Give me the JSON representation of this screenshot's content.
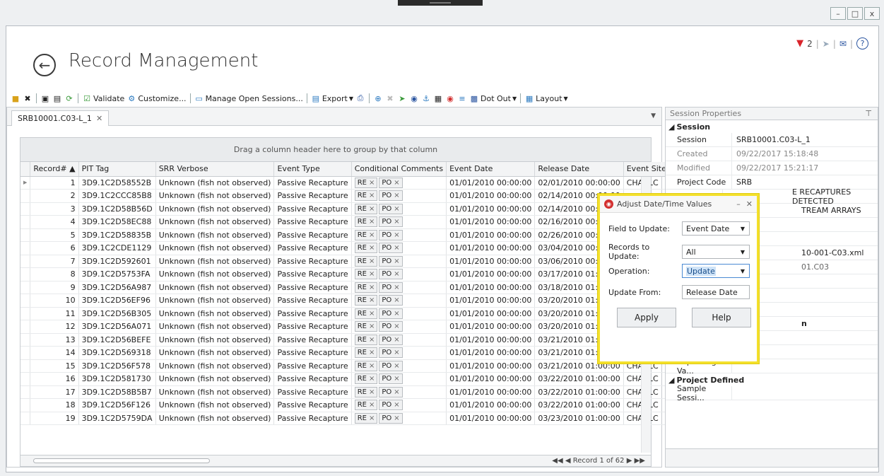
{
  "window": {
    "minimize": "–",
    "maximize": "□",
    "close": "x"
  },
  "header": {
    "title": "Record Management",
    "flag_count": "2"
  },
  "toolbar": {
    "validate": "Validate",
    "customize": "Customize...",
    "manage_sessions": "Manage Open Sessions...",
    "export": "Export",
    "dot_out": "Dot Out",
    "layout": "Layout"
  },
  "tab": {
    "label": "SRB10001.C03-L_1"
  },
  "grid": {
    "group_hint": "Drag a column header here to group by that column",
    "columns": [
      "Record#",
      "PIT Tag",
      "SRR Verbose",
      "Event Type",
      "Conditional Comments",
      "Event Date",
      "Release Date",
      "Event Site"
    ],
    "rows": [
      [
        "1",
        "3D9.1C2D58552B",
        "Unknown (fish not observed)",
        "Passive Recapture",
        "01/01/2010 00:00:00",
        "02/01/2010 00:00:00",
        "CHARLC"
      ],
      [
        "2",
        "3D9.1C2CCC85B8",
        "Unknown (fish not observed)",
        "Passive Recapture",
        "01/01/2010 00:00:00",
        "02/14/2010 00:00:00",
        ""
      ],
      [
        "3",
        "3D9.1C2D58B56D",
        "Unknown (fish not observed)",
        "Passive Recapture",
        "01/01/2010 00:00:00",
        "02/14/2010 00:00:00",
        ""
      ],
      [
        "4",
        "3D9.1C2D58EC88",
        "Unknown (fish not observed)",
        "Passive Recapture",
        "01/01/2010 00:00:00",
        "02/16/2010 00:00:00",
        ""
      ],
      [
        "5",
        "3D9.1C2D58835B",
        "Unknown (fish not observed)",
        "Passive Recapture",
        "01/01/2010 00:00:00",
        "02/26/2010 00:00:00",
        ""
      ],
      [
        "6",
        "3D9.1C2CDE1129",
        "Unknown (fish not observed)",
        "Passive Recapture",
        "01/01/2010 00:00:00",
        "03/04/2010 00:00:00",
        ""
      ],
      [
        "7",
        "3D9.1C2D592601",
        "Unknown (fish not observed)",
        "Passive Recapture",
        "01/01/2010 00:00:00",
        "03/06/2010 00:00:00",
        ""
      ],
      [
        "8",
        "3D9.1C2D5753FA",
        "Unknown (fish not observed)",
        "Passive Recapture",
        "01/01/2010 00:00:00",
        "03/17/2010 01:00:00",
        ""
      ],
      [
        "9",
        "3D9.1C2D56A987",
        "Unknown (fish not observed)",
        "Passive Recapture",
        "01/01/2010 00:00:00",
        "03/18/2010 01:00:00",
        ""
      ],
      [
        "10",
        "3D9.1C2D56EF96",
        "Unknown (fish not observed)",
        "Passive Recapture",
        "01/01/2010 00:00:00",
        "03/20/2010 01:00:00",
        ""
      ],
      [
        "11",
        "3D9.1C2D56B305",
        "Unknown (fish not observed)",
        "Passive Recapture",
        "01/01/2010 00:00:00",
        "03/20/2010 01:00:00",
        ""
      ],
      [
        "12",
        "3D9.1C2D56A071",
        "Unknown (fish not observed)",
        "Passive Recapture",
        "01/01/2010 00:00:00",
        "03/20/2010 01:00:00",
        ""
      ],
      [
        "13",
        "3D9.1C2D56BEFE",
        "Unknown (fish not observed)",
        "Passive Recapture",
        "01/01/2010 00:00:00",
        "03/21/2010 01:00:00",
        ""
      ],
      [
        "14",
        "3D9.1C2D569318",
        "Unknown (fish not observed)",
        "Passive Recapture",
        "01/01/2010 00:00:00",
        "03/21/2010 01:00:00",
        "CHARLC"
      ],
      [
        "15",
        "3D9.1C2D56F578",
        "Unknown (fish not observed)",
        "Passive Recapture",
        "01/01/2010 00:00:00",
        "03/21/2010 01:00:00",
        "CHARLC"
      ],
      [
        "16",
        "3D9.1C2D581730",
        "Unknown (fish not observed)",
        "Passive Recapture",
        "01/01/2010 00:00:00",
        "03/22/2010 01:00:00",
        "CHARLC"
      ],
      [
        "17",
        "3D9.1C2D58B5B7",
        "Unknown (fish not observed)",
        "Passive Recapture",
        "01/01/2010 00:00:00",
        "03/22/2010 01:00:00",
        "CHARLC"
      ],
      [
        "18",
        "3D9.1C2D56F126",
        "Unknown (fish not observed)",
        "Passive Recapture",
        "01/01/2010 00:00:00",
        "03/22/2010 01:00:00",
        "CHARLC"
      ],
      [
        "19",
        "3D9.1C2D5759DA",
        "Unknown (fish not observed)",
        "Passive Recapture",
        "01/01/2010 00:00:00",
        "03/23/2010 01:00:00",
        "CHARLC"
      ]
    ],
    "chips": [
      "RE",
      "PO"
    ],
    "pager": "Record 1 of 62"
  },
  "session_properties": {
    "title": "Session Properties",
    "category_session": "Session",
    "rows": [
      {
        "k": "Session",
        "v": "SRB10001.C03-L_1",
        "dim": false
      },
      {
        "k": "Created",
        "v": "09/22/2017 15:18:48",
        "dim": true
      },
      {
        "k": "Modified",
        "v": "09/22/2017 15:21:17",
        "dim": true
      },
      {
        "k": "Project Code",
        "v": "SRB",
        "dim": false
      }
    ],
    "partial_1": "E  RECAPTURES  DETECTED",
    "partial_2": "TREAM ARRAYS",
    "partial_3": "10-001-C03.xml",
    "partial_4": "01.C03",
    "partial_5": "n",
    "repeating": "Repeating Va...",
    "category_project": "Project Defined",
    "sample": "Sample Sessi..."
  },
  "dialog": {
    "title": "Adjust Date/Time Values",
    "field_label": "Field to Update:",
    "field_value": "Event Date",
    "records_label": "Records to Update:",
    "records_value": "All",
    "operation_label": "Operation:",
    "operation_value": "Update",
    "from_label": "Update From:",
    "from_value": "Release Date",
    "apply": "Apply",
    "help": "Help"
  },
  "colors": {
    "highlight": "#f4e02c",
    "flag": "#d9242b"
  }
}
